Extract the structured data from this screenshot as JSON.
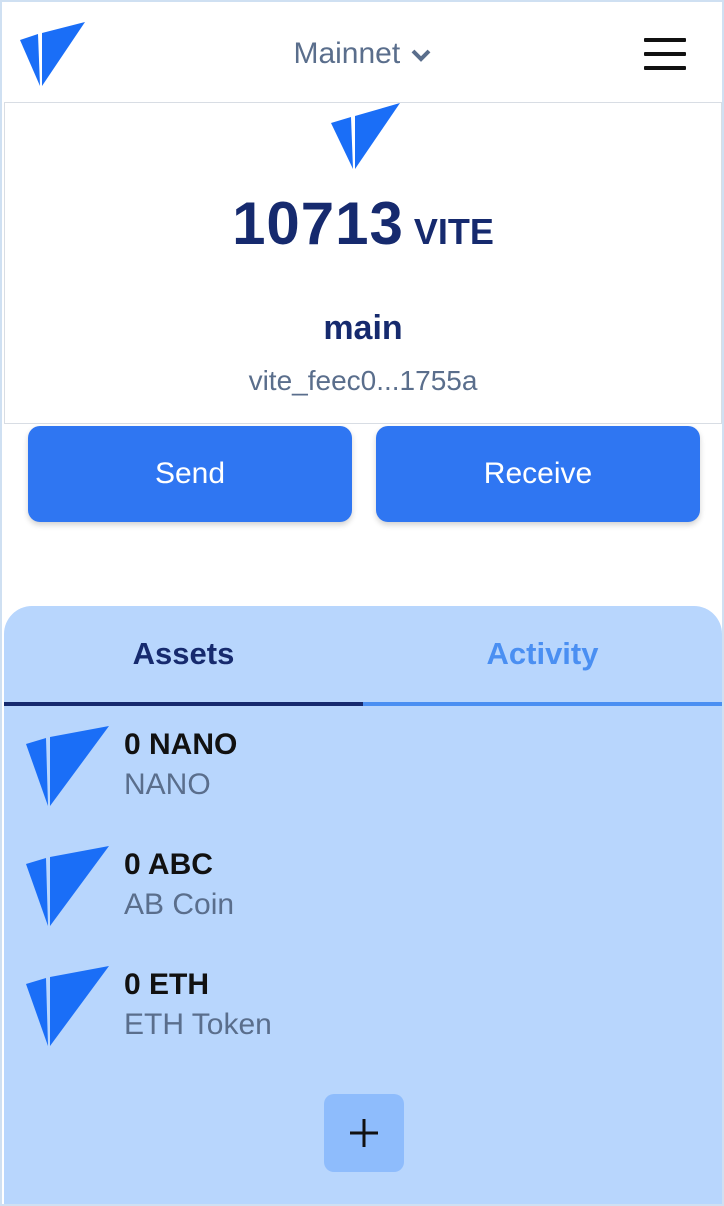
{
  "colors": {
    "brand_blue": "#1a6ef7",
    "button_blue": "#2f76f2",
    "panel_bg": "#b8d6fd",
    "dark_navy": "#162a6e",
    "active_tab": "#162a6e",
    "inactive_tab": "#4a8ff2"
  },
  "header": {
    "logo_icon": "vite-logo-icon",
    "network": "Mainnet",
    "network_icon": "chevron-down-icon",
    "menu_icon": "hamburger-menu-icon"
  },
  "account": {
    "balance": "10713",
    "unit": "VITE",
    "name": "main",
    "address": "vite_feec0...1755a"
  },
  "actions": {
    "send_label": "Send",
    "receive_label": "Receive"
  },
  "tabs": [
    {
      "label": "Assets",
      "active": true
    },
    {
      "label": "Activity",
      "active": false
    }
  ],
  "assets": [
    {
      "balance": "0 NANO",
      "name": "NANO",
      "icon": "vite-token-icon"
    },
    {
      "balance": "0 ABC",
      "name": "AB Coin",
      "icon": "vite-token-icon"
    },
    {
      "balance": "0 ETH",
      "name": "ETH Token",
      "icon": "vite-token-icon"
    }
  ],
  "add_button_icon": "plus-icon"
}
